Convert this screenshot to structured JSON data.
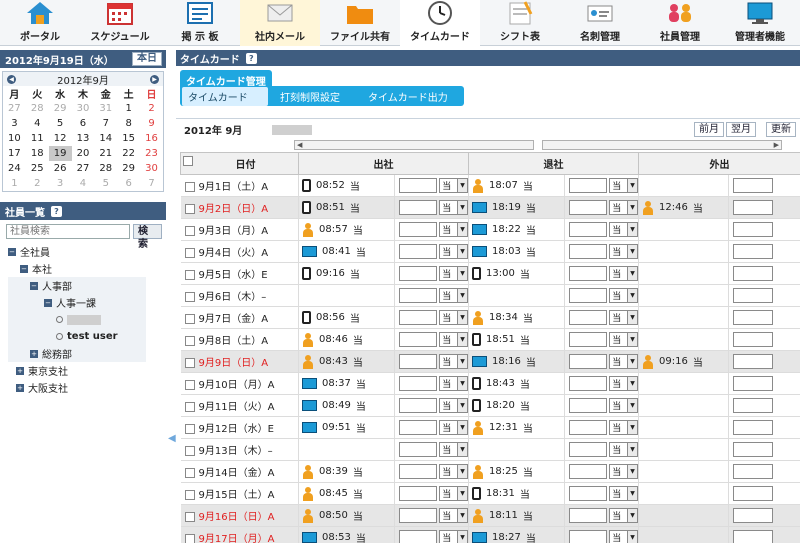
{
  "nav": [
    {
      "label": "ポータル",
      "icon": "home-icon"
    },
    {
      "label": "スケジュール",
      "icon": "calendar-icon"
    },
    {
      "label": "掲 示 板",
      "icon": "bulletin-icon"
    },
    {
      "label": "社内メール",
      "icon": "mail-icon"
    },
    {
      "label": "ファイル共有",
      "icon": "folder-icon"
    },
    {
      "label": "タイムカード",
      "icon": "clock-icon"
    },
    {
      "label": "シフト表",
      "icon": "shift-icon"
    },
    {
      "label": "名刺管理",
      "icon": "card-icon"
    },
    {
      "label": "社員管理",
      "icon": "people-icon"
    },
    {
      "label": "管理者機能",
      "icon": "admin-icon"
    }
  ],
  "sidebar": {
    "date": "2012年9月19日（水）",
    "today_btn": "本日",
    "calendar": {
      "month": "2012年9月",
      "weekdays": [
        "月",
        "火",
        "水",
        "木",
        "金",
        "土",
        "日"
      ],
      "weeks": [
        [
          "27",
          "28",
          "29",
          "30",
          "31",
          "1",
          "2"
        ],
        [
          "3",
          "4",
          "5",
          "6",
          "7",
          "8",
          "9"
        ],
        [
          "10",
          "11",
          "12",
          "13",
          "14",
          "15",
          "16"
        ],
        [
          "17",
          "18",
          "19",
          "20",
          "21",
          "22",
          "23"
        ],
        [
          "24",
          "25",
          "26",
          "27",
          "28",
          "29",
          "30"
        ],
        [
          "1",
          "2",
          "3",
          "4",
          "5",
          "6",
          "7"
        ]
      ]
    },
    "employee_list_title": "社員一覧",
    "search_placeholder": "社員検索",
    "search_btn": "検索",
    "tree": {
      "all": "全社員",
      "hq": "本社",
      "hr": "人事部",
      "hr1": "人事一課",
      "user2": "test user",
      "general": "総務部",
      "tokyo": "東京支社",
      "osaka": "大阪支社"
    }
  },
  "main": {
    "title": "タイムカード",
    "tab_mgr": "タイムカード管理",
    "subtabs": [
      "タイムカード",
      "打刻制限設定",
      "タイムカード出力"
    ],
    "month": "2012年 9月",
    "prev": "前月",
    "next": "翌月",
    "refresh": "更新",
    "headers": {
      "date": "日付",
      "in": "出社",
      "out": "退社",
      "away": "外出"
    },
    "stamp": "当",
    "rows": [
      {
        "date": "9月1日（土）A",
        "in_icon": "phone",
        "in": "08:52",
        "out_icon": "person",
        "out": "18:07",
        "away_icon": "",
        "away": "",
        "gray": false,
        "sun": false
      },
      {
        "date": "9月2日（日）A",
        "in_icon": "phone",
        "in": "08:51",
        "out_icon": "pc",
        "out": "18:19",
        "away_icon": "person",
        "away": "12:46",
        "gray": true,
        "sun": true
      },
      {
        "date": "9月3日（月）A",
        "in_icon": "person",
        "in": "08:57",
        "out_icon": "pc",
        "out": "18:22",
        "away_icon": "",
        "away": "",
        "gray": false,
        "sun": false
      },
      {
        "date": "9月4日（火）A",
        "in_icon": "pc",
        "in": "08:41",
        "out_icon": "pc",
        "out": "18:03",
        "away_icon": "",
        "away": "",
        "gray": false,
        "sun": false
      },
      {
        "date": "9月5日（水）E",
        "in_icon": "phone",
        "in": "09:16",
        "out_icon": "phone",
        "out": "13:00",
        "away_icon": "",
        "away": "",
        "gray": false,
        "sun": false
      },
      {
        "date": "9月6日（木）–",
        "in_icon": "",
        "in": "",
        "out_icon": "",
        "out": "",
        "away_icon": "",
        "away": "",
        "gray": false,
        "sun": false
      },
      {
        "date": "9月7日（金）A",
        "in_icon": "phone",
        "in": "08:56",
        "out_icon": "person",
        "out": "18:34",
        "away_icon": "",
        "away": "",
        "gray": false,
        "sun": false
      },
      {
        "date": "9月8日（土）A",
        "in_icon": "person",
        "in": "08:46",
        "out_icon": "phone",
        "out": "18:51",
        "away_icon": "",
        "away": "",
        "gray": false,
        "sun": false
      },
      {
        "date": "9月9日（日）A",
        "in_icon": "person",
        "in": "08:43",
        "out_icon": "pc",
        "out": "18:16",
        "away_icon": "person",
        "away": "09:16",
        "gray": true,
        "sun": true
      },
      {
        "date": "9月10日（月）A",
        "in_icon": "pc",
        "in": "08:37",
        "out_icon": "phone",
        "out": "18:43",
        "away_icon": "",
        "away": "",
        "gray": false,
        "sun": false
      },
      {
        "date": "9月11日（火）A",
        "in_icon": "pc",
        "in": "08:49",
        "out_icon": "phone",
        "out": "18:20",
        "away_icon": "",
        "away": "",
        "gray": false,
        "sun": false
      },
      {
        "date": "9月12日（水）E",
        "in_icon": "pc",
        "in": "09:51",
        "out_icon": "person",
        "out": "12:31",
        "away_icon": "",
        "away": "",
        "gray": false,
        "sun": false
      },
      {
        "date": "9月13日（木）–",
        "in_icon": "",
        "in": "",
        "out_icon": "",
        "out": "",
        "away_icon": "",
        "away": "",
        "gray": false,
        "sun": false
      },
      {
        "date": "9月14日（金）A",
        "in_icon": "person",
        "in": "08:39",
        "out_icon": "person",
        "out": "18:25",
        "away_icon": "",
        "away": "",
        "gray": false,
        "sun": false
      },
      {
        "date": "9月15日（土）A",
        "in_icon": "person",
        "in": "08:45",
        "out_icon": "phone",
        "out": "18:31",
        "away_icon": "",
        "away": "",
        "gray": false,
        "sun": false
      },
      {
        "date": "9月16日（日）A",
        "in_icon": "person",
        "in": "08:50",
        "out_icon": "person",
        "out": "18:11",
        "away_icon": "",
        "away": "",
        "gray": true,
        "sun": true
      },
      {
        "date": "9月17日（月）A",
        "in_icon": "pc",
        "in": "08:53",
        "out_icon": "pc",
        "out": "18:27",
        "away_icon": "",
        "away": "",
        "gray": true,
        "sun": true
      }
    ]
  },
  "colors": {
    "header_blue": "#3f5d80",
    "tab_blue": "#1fa7e0",
    "sunday_red": "#e02020"
  }
}
